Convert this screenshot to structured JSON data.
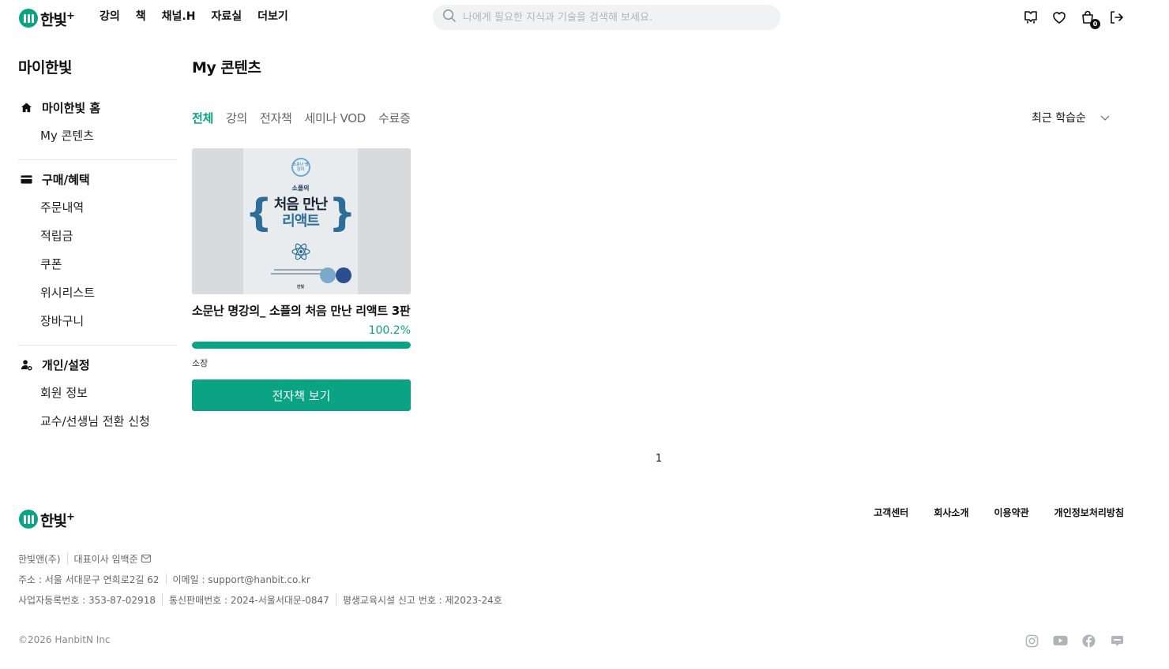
{
  "header": {
    "logo_text": "한빛",
    "logo_plus": "+",
    "nav": [
      "강의",
      "책",
      "채널.H",
      "자료실",
      "더보기"
    ],
    "search_placeholder": "나에게 필요한 지식과 기술을 검색해 보세요.",
    "cart_count": "0"
  },
  "sidebar": {
    "title": "마이한빛",
    "groups": [
      {
        "label": "마이한빛 홈",
        "icon": "home-icon",
        "items": [
          "My 콘텐츠"
        ]
      },
      {
        "label": "구매/혜택",
        "icon": "card-icon",
        "items": [
          "주문내역",
          "적립금",
          "쿠폰",
          "위시리스트",
          "장바구니"
        ]
      },
      {
        "label": "개인/설정",
        "icon": "user-gear-icon",
        "items": [
          "회원 정보",
          "교수/선생님 전환 신청"
        ]
      }
    ]
  },
  "main": {
    "title": "My 콘텐츠",
    "tabs": [
      "전체",
      "강의",
      "전자책",
      "세미나 VOD",
      "수료증"
    ],
    "active_tab": "전체",
    "sort_label": "최근 학습순",
    "items": [
      {
        "title": "소문난 명강의_ 소플의 처음 만난 리액트 3판",
        "progress_text": "100.2%",
        "progress": 1.0,
        "status": "소장",
        "button": "전자책 보기",
        "cover": {
          "badge": "소문난 명강의",
          "subtitle": "소플의",
          "line1": "처음 만난",
          "line2": "리액트",
          "publisher": "한빛"
        }
      }
    ],
    "page": "1"
  },
  "footer": {
    "logo_text": "한빛",
    "logo_plus": "+",
    "links": [
      "고객센터",
      "회사소개",
      "이용약관",
      "개인정보처리방침"
    ],
    "company": "한빛앤(주)",
    "ceo": "대표이사 임백준",
    "address": "주소 : 서울 서대문구 연희로2길 62",
    "email": "이메일 : support@hanbit.co.kr",
    "biz_no": "사업자등록번호 : 353-87-02918",
    "sales_no": "통신판매번호 : 2024-서울서대문-0847",
    "edu_no": "평생교육시설 신고 번호 : 제2023-24호",
    "copyright": "©2026 HanbitN Inc",
    "socials": [
      "instagram-icon",
      "youtube-icon",
      "facebook-icon",
      "blog-icon"
    ]
  },
  "colors": {
    "accent": "#0aa383",
    "text": "#111111",
    "muted": "#666666"
  }
}
